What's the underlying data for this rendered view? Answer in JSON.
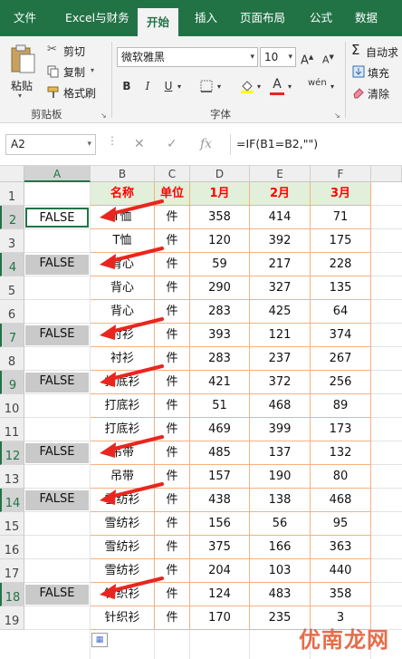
{
  "ribbon_tabs": [
    "文件",
    "Excel与财务",
    "开始",
    "插入",
    "页面布局",
    "公式",
    "数据"
  ],
  "active_tab": "开始",
  "clipboard": {
    "paste": "粘贴",
    "cut": "剪切",
    "copy": "复制",
    "format_painter": "格式刷",
    "group_label": "剪贴板"
  },
  "font": {
    "name": "微软雅黑",
    "size": "10",
    "bold": "B",
    "italic": "I",
    "underline": "U",
    "grow": "A",
    "shrink": "A",
    "phonetic": "wén",
    "group_label": "字体"
  },
  "editing": {
    "autosum": "自动求",
    "fill": "填充",
    "clear": "清除"
  },
  "formula_bar": {
    "name_box": "A2",
    "cancel": "✕",
    "enter": "✓",
    "fx": "fx",
    "formula": "=IF(B1=B2,\"\")"
  },
  "columns": [
    "A",
    "B",
    "C",
    "D",
    "E",
    "F"
  ],
  "rows": [
    "1",
    "2",
    "3",
    "4",
    "5",
    "6",
    "7",
    "8",
    "9",
    "10",
    "11",
    "12",
    "13",
    "14",
    "15",
    "16",
    "17",
    "18",
    "19"
  ],
  "header_row": [
    "名称",
    "单位",
    "1月",
    "2月",
    "3月"
  ],
  "table": [
    {
      "a": "FALSE",
      "name": "T恤",
      "unit": "件",
      "m1": "358",
      "m2": "414",
      "m3": "71"
    },
    {
      "a": "",
      "name": "T恤",
      "unit": "件",
      "m1": "120",
      "m2": "392",
      "m3": "175"
    },
    {
      "a": "FALSE",
      "name": "背心",
      "unit": "件",
      "m1": "59",
      "m2": "217",
      "m3": "228"
    },
    {
      "a": "",
      "name": "背心",
      "unit": "件",
      "m1": "290",
      "m2": "327",
      "m3": "135"
    },
    {
      "a": "",
      "name": "背心",
      "unit": "件",
      "m1": "283",
      "m2": "425",
      "m3": "64"
    },
    {
      "a": "FALSE",
      "name": "衬衫",
      "unit": "件",
      "m1": "393",
      "m2": "121",
      "m3": "374"
    },
    {
      "a": "",
      "name": "衬衫",
      "unit": "件",
      "m1": "283",
      "m2": "237",
      "m3": "267"
    },
    {
      "a": "FALSE",
      "name": "打底衫",
      "unit": "件",
      "m1": "421",
      "m2": "372",
      "m3": "256"
    },
    {
      "a": "",
      "name": "打底衫",
      "unit": "件",
      "m1": "51",
      "m2": "468",
      "m3": "89"
    },
    {
      "a": "",
      "name": "打底衫",
      "unit": "件",
      "m1": "469",
      "m2": "399",
      "m3": "173"
    },
    {
      "a": "FALSE",
      "name": "吊带",
      "unit": "件",
      "m1": "485",
      "m2": "137",
      "m3": "132"
    },
    {
      "a": "",
      "name": "吊带",
      "unit": "件",
      "m1": "157",
      "m2": "190",
      "m3": "80"
    },
    {
      "a": "FALSE",
      "name": "雪纺衫",
      "unit": "件",
      "m1": "438",
      "m2": "138",
      "m3": "468"
    },
    {
      "a": "",
      "name": "雪纺衫",
      "unit": "件",
      "m1": "156",
      "m2": "56",
      "m3": "95"
    },
    {
      "a": "",
      "name": "雪纺衫",
      "unit": "件",
      "m1": "375",
      "m2": "166",
      "m3": "363"
    },
    {
      "a": "",
      "name": "雪纺衫",
      "unit": "件",
      "m1": "204",
      "m2": "103",
      "m3": "440"
    },
    {
      "a": "FALSE",
      "name": "针织衫",
      "unit": "件",
      "m1": "124",
      "m2": "483",
      "m3": "358"
    },
    {
      "a": "",
      "name": "针织衫",
      "unit": "件",
      "m1": "170",
      "m2": "235",
      "m3": "3"
    }
  ],
  "watermark": "优南龙网",
  "colors": {
    "accent": "#217346",
    "arrow": "#e8261f",
    "header_fill": "#e2efda",
    "header_text": "#ff0000",
    "false_fill": "#c9c9c9",
    "table_border": "#f4b183"
  }
}
